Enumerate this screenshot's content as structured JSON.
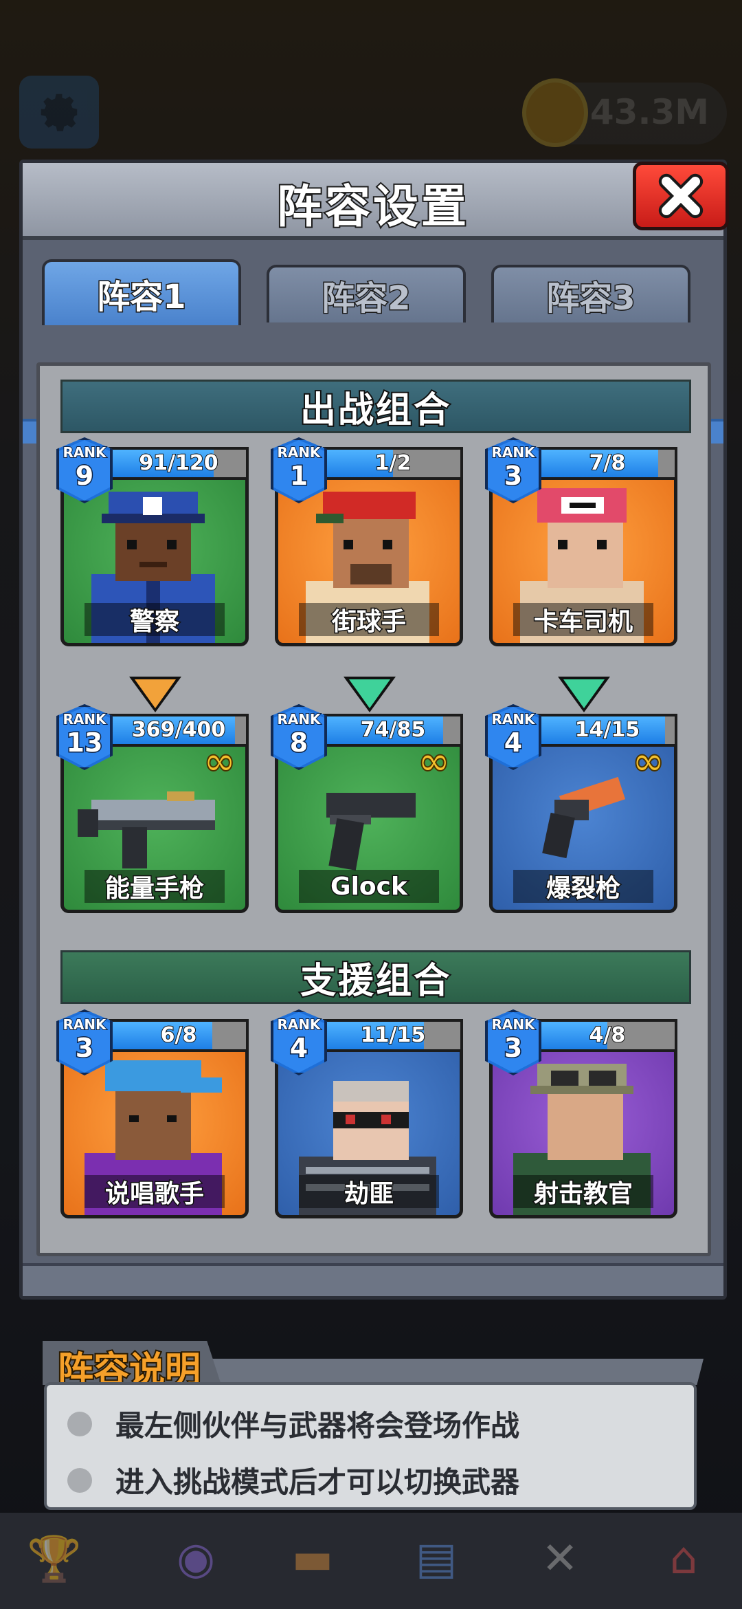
{
  "hud": {
    "coins": "43.3M"
  },
  "modal": {
    "title": "阵容设置",
    "tabs": [
      "阵容1",
      "阵容2",
      "阵容3"
    ],
    "active_tab": 0
  },
  "sections": {
    "battle": "出战组合",
    "support": "支援组合"
  },
  "rank_label": "RANK",
  "battle_partners": [
    {
      "name": "警察",
      "rank": "9",
      "progress": "91/120",
      "fill": 0.76,
      "bg": "green"
    },
    {
      "name": "街球手",
      "rank": "1",
      "progress": "1/2",
      "fill": 0.5,
      "bg": "orange"
    },
    {
      "name": "卡车司机",
      "rank": "3",
      "progress": "7/8",
      "fill": 0.88,
      "bg": "orange"
    }
  ],
  "weapons": [
    {
      "name": "能量手枪",
      "rank": "13",
      "progress": "369/400",
      "fill": 0.92,
      "bg": "green"
    },
    {
      "name": "Glock",
      "rank": "8",
      "progress": "74/85",
      "fill": 0.87,
      "bg": "green"
    },
    {
      "name": "爆裂枪",
      "rank": "4",
      "progress": "14/15",
      "fill": 0.93,
      "bg": "blue"
    }
  ],
  "support_partners": [
    {
      "name": "说唱歌手",
      "rank": "3",
      "progress": "6/8",
      "fill": 0.75,
      "bg": "orange"
    },
    {
      "name": "劫匪",
      "rank": "4",
      "progress": "11/15",
      "fill": 0.73,
      "bg": "blue"
    },
    {
      "name": "射击教官",
      "rank": "3",
      "progress": "4/8",
      "fill": 0.5,
      "bg": "purple"
    }
  ],
  "description": {
    "title": "阵容说明",
    "lines": [
      "最左侧伙伴与武器将会登场作战",
      "进入挑战模式后才可以切换武器"
    ]
  },
  "colors": {
    "accent_blue": "#4a82cc",
    "close_red": "#e02a20",
    "title_orange": "#f5a02a"
  }
}
